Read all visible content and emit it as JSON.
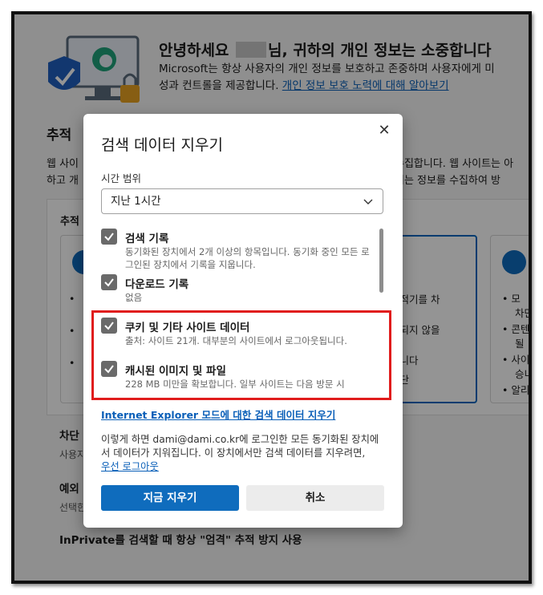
{
  "background": {
    "hero_title_prefix": "안녕하세요",
    "hero_title_suffix": "님, 귀하의 개인 정보는 소중합니다",
    "hero_line1": "Microsoft는 항상 사용자의 개인 정보를 보호하고 존중하며 사용자에게 미",
    "hero_line2_text": "성과 컨트롤을 제공합니다.",
    "hero_link": "개인 정보 보호 노력에 대해 알아보기",
    "section_title": "추적",
    "section_line1_left": "웹 사이",
    "section_line1_right": "수집합니다. 웹 사이트는 아",
    "section_line2_left": "하고 개",
    "section_line2_right": "기는 정보를 수집하여 방",
    "card_area_label": "추적",
    "mid_card_bullets": [
      "추적기를 차",
      "정되지 않을",
      "합니다",
      "차단"
    ],
    "right_card_bullets": [
      "모",
      "차만",
      "콘텐",
      "될",
      "사이",
      "승니",
      "알리"
    ],
    "row_block": "차단",
    "row_block_sub": "사용자",
    "row_except": "예외",
    "row_except_sub": "선택한",
    "row_inprivate": "InPrivate를 검색할 때 항상 \"엄격\" 추적 방지 사용"
  },
  "dialog": {
    "title": "검색 데이터 지우기",
    "time_range_label": "시간 범위",
    "time_range_value": "지난 1시간",
    "options": [
      {
        "title": "검색 기록",
        "desc": "동기화된 장치에서 2개 이상의 항목입니다. 동기화 중인 모든 로그인된 장치에서 기록을 지웁니다.",
        "checked": true
      },
      {
        "title": "다운로드 기록",
        "desc": "없음",
        "checked": true
      },
      {
        "title": "쿠키 및 기타 사이트 데이터",
        "desc": "출처: 사이트 21개. 대부분의 사이트에서 로그아웃됩니다.",
        "checked": true
      },
      {
        "title": "캐시된 이미지 및 파일",
        "desc": "228 MB 미만을 확보합니다. 일부 사이트는 다음 방문 시",
        "checked": true
      }
    ],
    "ie_link": "Internet Explorer 모드에 대한 검색 데이터 지우기",
    "info_text": "이렇게 하면 dami@dami.co.kr에 로그인한 모든 동기화된 장치에서 데이터가 지워집니다. 이 장치에서만 검색 데이터를 지우려면,",
    "signout_link": "우선 로그아웃",
    "clear_now": "지금 지우기",
    "cancel": "취소"
  },
  "colors": {
    "accent": "#0f6cbd",
    "highlight_box": "#e01c1c",
    "checkbox": "#6a6a6a"
  }
}
